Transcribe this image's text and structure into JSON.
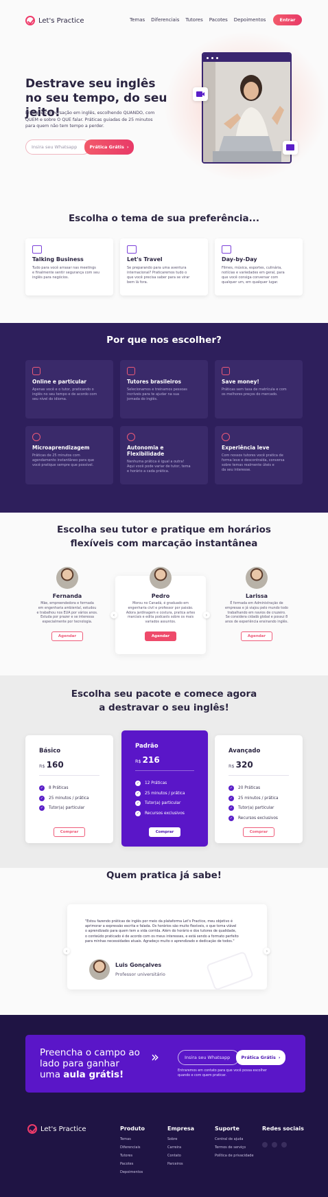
{
  "header": {
    "brand": "Let's Practice",
    "nav": [
      "Temas",
      "Diferenciais",
      "Tutores",
      "Pacotes",
      "Depoimentos"
    ],
    "cta": "Entrar"
  },
  "hero": {
    "title_line1": "Destrave seu inglês",
    "title_line2": "no seu tempo, do seu jeito!",
    "sub_line1": "Pratique conversação em inglês, escolhendo QUANDO, com",
    "sub_line2": "QUEM e sobre O QUE  falar. Práticas guiadas de 25 minutos",
    "sub_line3": "para quem não tem tempo a perder.",
    "input_placeholder": "Insira seu Whatsapp",
    "button": "Prática Grátis"
  },
  "themes": {
    "title": "Escolha o tema de sua preferência...",
    "items": [
      {
        "name": "Talking Business",
        "icon": "briefcase-icon",
        "desc_1": "Tudo para você arrasar nas meetings",
        "desc_2": "e finalmente sentir segurança com seu",
        "desc_3": "inglês para negócios."
      },
      {
        "name": "Let's Travel",
        "icon": "map-icon",
        "desc_1": "Se preparando para uma aventura",
        "desc_2": "internacional? Praticaremos tudo o",
        "desc_3": "que você precisa saber para se virar",
        "desc_4": "bem lá fora."
      },
      {
        "name": "Day-by-Day",
        "icon": "coffee-cup-icon",
        "desc_1": "Filmes, música, esportes, culinária,",
        "desc_2": "notícias e variedades em geral, para",
        "desc_3": "que você consiga conversar com",
        "desc_4": "qualquer um, em qualquer lugar."
      }
    ]
  },
  "why": {
    "title": "Por que nos escolher?",
    "items": [
      {
        "name": "Online e particular",
        "icon": "lock-icon",
        "d1": "Apenas você e o tutor, praticando o",
        "d2": "inglês no seu tempo e de acordo com",
        "d3": "seu nível do idioma."
      },
      {
        "name": "Tutores brasileiros",
        "icon": "edit-icon",
        "d1": "Selecionamos e treinamos pessoas",
        "d2": "incríveis para te ajudar na sua",
        "d3": "jornada do inglês."
      },
      {
        "name": "Save money!",
        "icon": "database-icon",
        "d1": "Práticas sem taxa de matrícula e com",
        "d2": "os melhores preços do mercado.",
        "d3": ""
      },
      {
        "name": "Microaprendizagem",
        "icon": "clock-icon",
        "d1": "Práticas de 25 minutos com",
        "d2": "agendamento instantâneo para que",
        "d3": "você pratique sempre que possível."
      },
      {
        "name": "Autonomia e Flexibilidade",
        "icon": "check-circle-icon",
        "d1": "Nenhuma prática é igual a outra!",
        "d2": "Aqui você pode variar de tutor, tema",
        "d3": "e horário a cada prática."
      },
      {
        "name": "Experiência leve",
        "icon": "award-icon",
        "d1": "Com nossos tutores você pratica de",
        "d2": "forma leve e descontraída, conversa",
        "d3": "sobre temas realmente úteis e",
        "d4": "da seu interesse."
      }
    ]
  },
  "tutors": {
    "title_line1": "Escolha seu tutor e pratique em horários",
    "title_line2": "flexíveis com marcação instantânea",
    "button": "Agendar",
    "items": [
      {
        "name": "Fernanda",
        "b1": "Mãe, empreendedora e formada",
        "b2": "em engenharia ambiental, estudou",
        "b3": "e trabalhou nos EUA por vários anos.",
        "b4": "Estuda por prazer e se interessa",
        "b5": "especialmente por tecnologia."
      },
      {
        "name": "Pedro",
        "b1": "Morou no Canadá, é graduado em",
        "b2": "engenharia civil e professor por paixão.",
        "b3": "Adora jardinagem e costura, pratica artes",
        "b4": "marciais e edita podcasts sobre os mais",
        "b5": "variados assuntos."
      },
      {
        "name": "Larissa",
        "b1": "É formada em Administração de",
        "b2": "empresas e já viajou pelo mundo todo",
        "b3": "trabalhando em navios de cruzeiro.",
        "b4": "Se considera cidadã global e possui 8",
        "b5": "anos de experiência ensinando inglês."
      }
    ]
  },
  "pricing": {
    "title_line1": "Escolha seu pacote e comece agora",
    "title_line2": "a destravar o seu inglês!",
    "currency": "R$",
    "button": "Comprar",
    "plans": [
      {
        "name": "Básico",
        "price": "160",
        "features": [
          "8 Práticas",
          "25 minutos / prática",
          "Tutor(a) particular"
        ]
      },
      {
        "name": "Padrão",
        "price": "216",
        "features": [
          "12 Práticas",
          "25 minutos / prática",
          "Tutor(a) particular",
          "Recursos exclusivos"
        ]
      },
      {
        "name": "Avançado",
        "price": "320",
        "features": [
          "20 Práticas",
          "25 minutos / prática",
          "Tutor(a) particular",
          "Recursos exclusivos"
        ]
      }
    ]
  },
  "testimonial": {
    "title": "Quem pratica já sabe!",
    "q1": "\"Estou fazendo práticas de inglês por meio da plataforma Let's Practice, meu objetivo é",
    "q2": "aprimorar a expressão escrita e falada. Os horários são muito flexíveis, o que torna viável",
    "q3": "o aprendizado para quem tem a vida corrida.  Além do horário e dos tutores de qualidade,",
    "q4": "o conteúdo praticado é de acordo com os meus interesses, e está sendo a formato perfeito",
    "q5": "para minhas necessidades atuais. Agradeço muito o aprendizado e dedicação de todos.\"",
    "author": "Luis Gonçalves",
    "role": "Professor universitário"
  },
  "cta": {
    "l1": "Preencha o campo ao",
    "l2": "lado para ganhar",
    "l3a": "uma ",
    "l3b": "aula grátis!",
    "input_placeholder": "Insira seu Whatsapp",
    "button": "Prática Grátis",
    "note1": "Entraremos em contato para que você possa escolher",
    "note2": "quando e com quem praticar."
  },
  "footer": {
    "brand": "Let's Practice",
    "cols": [
      {
        "title": "Produto",
        "links": [
          "Temas",
          "Diferenciais",
          "Tutores",
          "Pacotes",
          "Depoimentos"
        ]
      },
      {
        "title": "Empresa",
        "links": [
          "Sobre",
          "Carreira",
          "Contato",
          "Parceiros"
        ]
      },
      {
        "title": "Suporte",
        "links": [
          "Central de ajuda",
          "Termos de serviço",
          "Política de privacidade"
        ]
      }
    ],
    "social_title": "Redes sociais",
    "social_icons": [
      "instagram-icon",
      "twitter-icon",
      "youtube-icon"
    ]
  },
  "colors": {
    "accent": "#ee4a6a",
    "purple": "#5a16c8",
    "dark": "#2e1f5c",
    "darkest": "#1f1444"
  }
}
